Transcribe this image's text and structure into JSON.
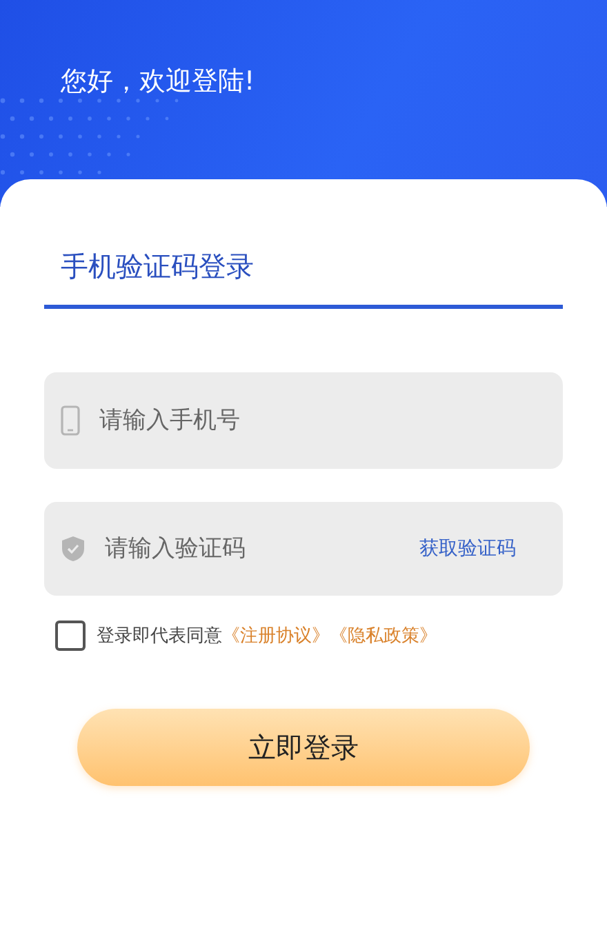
{
  "header": {
    "greeting": "您好，欢迎登陆!"
  },
  "tabs": [
    {
      "label": "手机验证码登录",
      "selected": true
    }
  ],
  "fields": [
    {
      "kind": "phone",
      "placeholder": "请输入手机号"
    },
    {
      "kind": "code",
      "placeholder": "请输入验证码",
      "action": "获取验证码"
    }
  ],
  "agreement": {
    "checked": false,
    "text": "登录即代表同意",
    "links": [
      "《注册协议》",
      "《隐私政策》"
    ]
  },
  "submit_button": "立即登录"
}
